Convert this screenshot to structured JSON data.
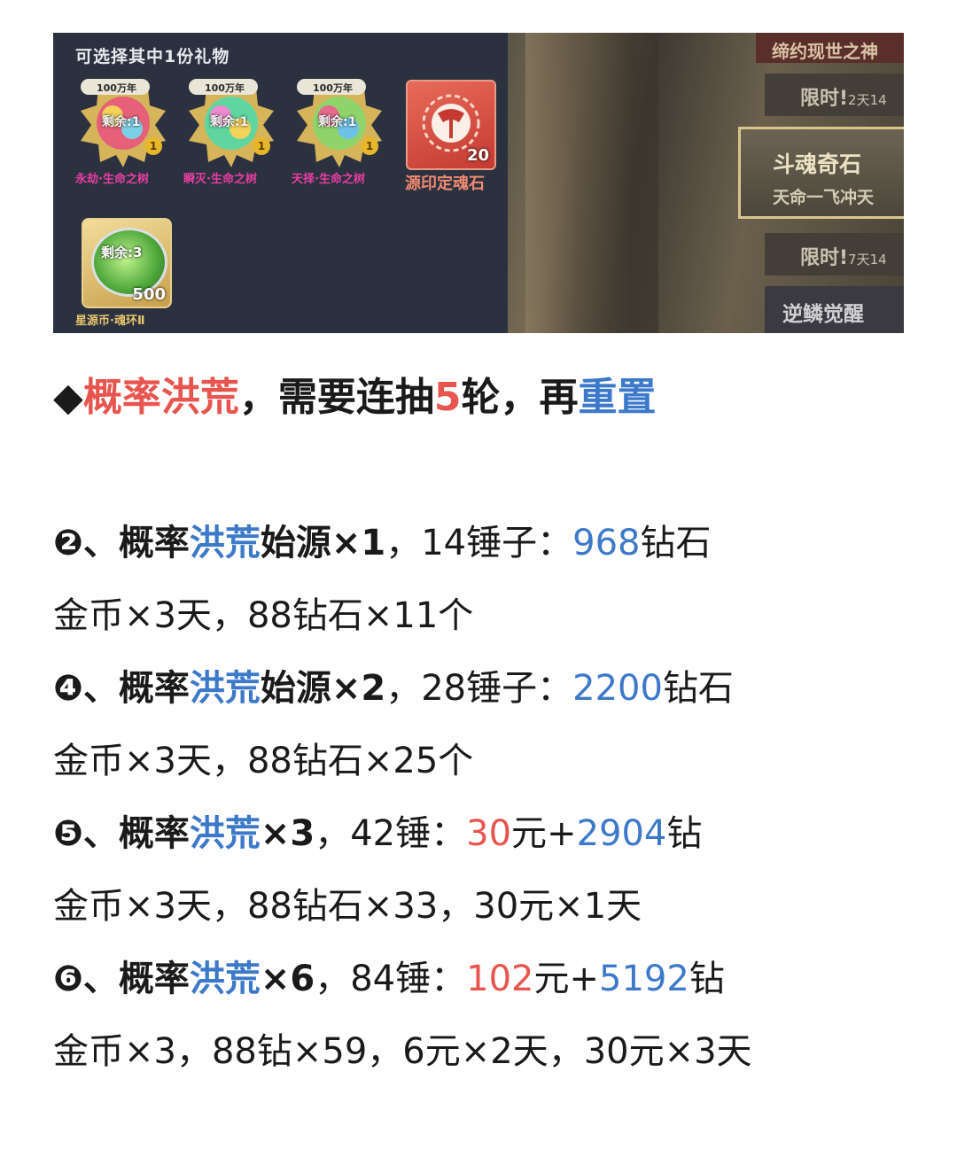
{
  "panel": {
    "title": "可选择其中1份礼物",
    "gifts": [
      {
        "age": "100万年",
        "remain": "剩余:1",
        "star": "1",
        "label": "永劫·生命之树"
      },
      {
        "age": "100万年",
        "remain": "剩余:1",
        "star": "1",
        "label": "瞬灭·生命之树"
      },
      {
        "age": "100万年",
        "remain": "剩余:1",
        "star": "1",
        "label": "天择·生命之树"
      }
    ],
    "stone": {
      "count": "20",
      "label": "源印定魂石"
    },
    "coin": {
      "remain": "剩余:3",
      "count": "500",
      "label": "星源币·魂环Ⅱ"
    },
    "side_tabs": {
      "pact": "缔约现世之神",
      "limit1_main": "限时!",
      "limit1_sub": "2天14",
      "stone_title": "斗魂奇石",
      "stone_sub": "天命一飞冲天",
      "limit2_main": "限时!",
      "limit2_sub": "7天14",
      "awaken": "逆鳞觉醒"
    }
  },
  "headline": {
    "bullet": "◆",
    "p1": "概率洪荒",
    "p2": "，需要连抽",
    "p3": "5",
    "p4": "轮，再",
    "p5": "重置"
  },
  "items": [
    {
      "num": "❷",
      "sep": "、",
      "b1": "概率",
      "b2": "洪荒",
      "b3": "始源×1",
      "t1": "，14锤子：",
      "v1": "968",
      "t2": "钻石",
      "detail": "金币×3天，88钻石×11个"
    },
    {
      "num": "❹",
      "sep": "、",
      "b1": "概率",
      "b2": "洪荒",
      "b3": "始源×2",
      "t1": "，28锤子：",
      "v1": "2200",
      "t2": "钻石",
      "detail": "金币×3天，88钻石×25个"
    },
    {
      "num": "❺",
      "sep": "、",
      "b1": "概率",
      "b2": "洪荒",
      "b3": "×3",
      "t1": "，42锤：",
      "r1": "30",
      "t2": "元+",
      "v1": "2904",
      "t3": "钻",
      "detail": "金币×3天，88钻石×33，30元×1天"
    },
    {
      "num": "❻",
      "sep": "、",
      "b1": "概率",
      "b2": "洪荒",
      "b3": "×6",
      "t1": "，84锤：",
      "r1": "102",
      "t2": "元+",
      "v1": "5192",
      "t3": "钻",
      "detail": "金币×3，88钻×59，6元×2天，30元×3天"
    }
  ],
  "colors": {
    "red": "#e8554f",
    "blue": "#3c79c9",
    "magenta": "#e83ea1"
  }
}
